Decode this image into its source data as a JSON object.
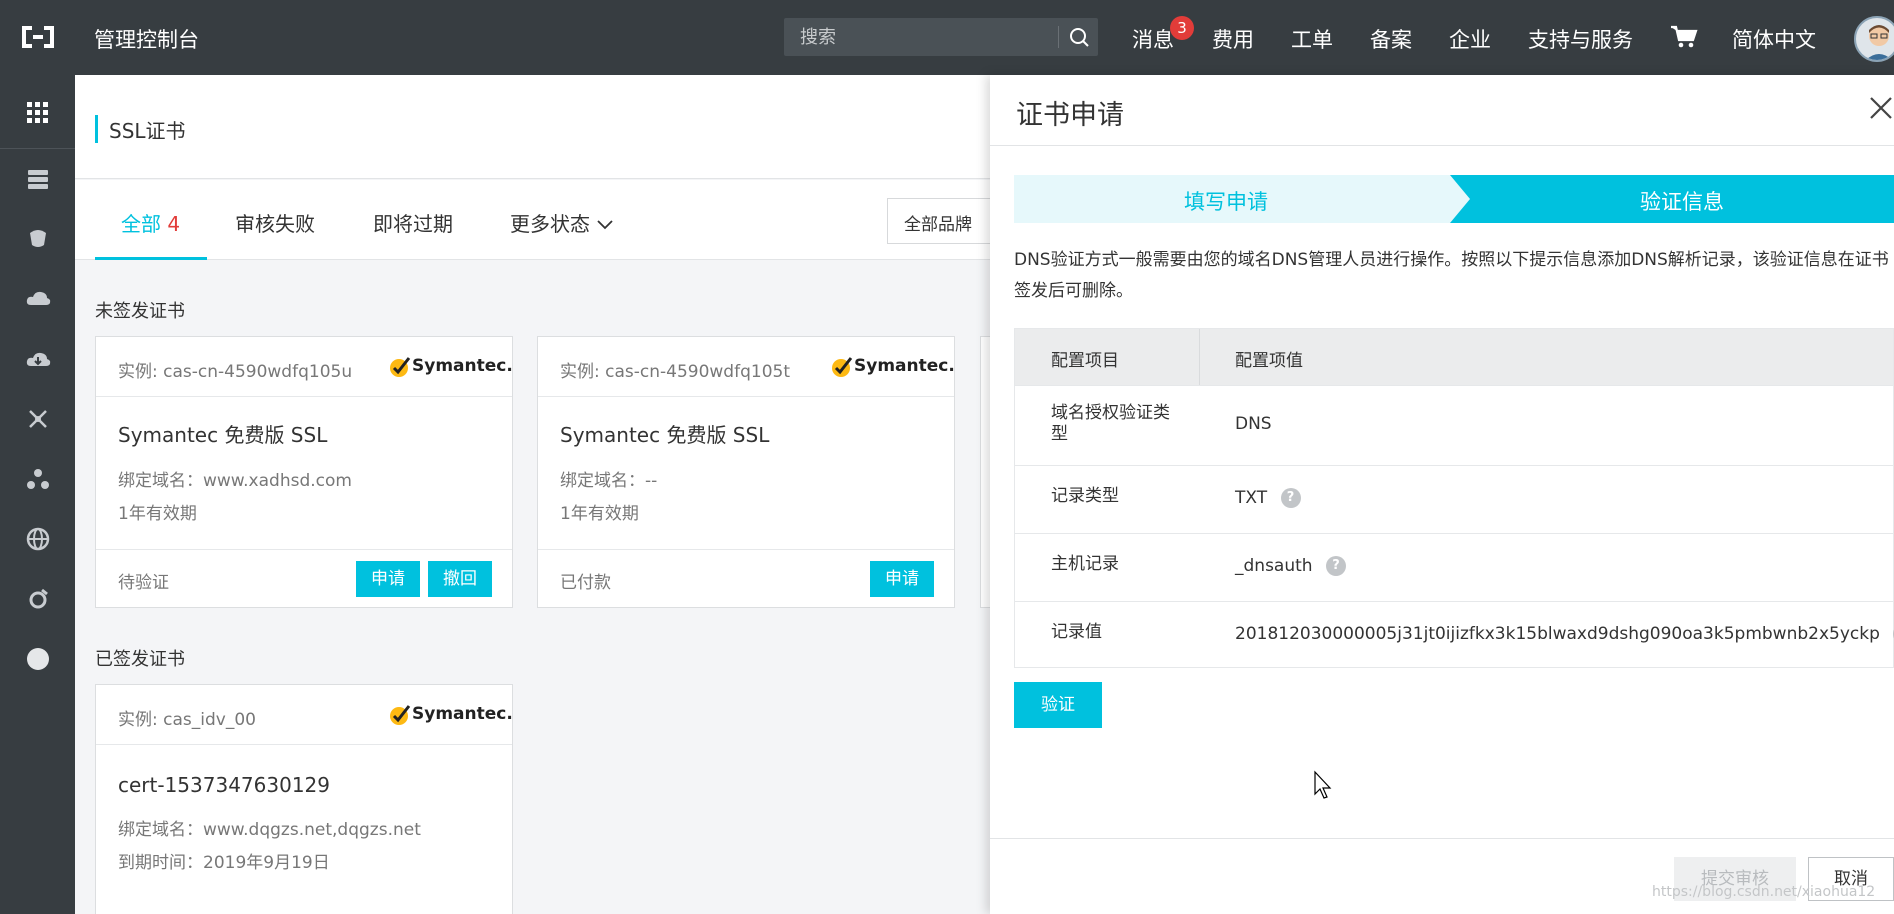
{
  "topbar": {
    "title": "管理控制台",
    "search_placeholder": "搜索",
    "nav": [
      {
        "label": "消息"
      },
      {
        "label": "费用"
      },
      {
        "label": "工单"
      },
      {
        "label": "备案"
      },
      {
        "label": "企业"
      },
      {
        "label": "支持与服务"
      },
      {
        "label": "简体中文"
      }
    ],
    "message_count": "3"
  },
  "header": {
    "title": "SSL证书"
  },
  "tabs": {
    "all_label": "全部",
    "all_count": "4",
    "items": [
      "审核失败",
      "即将过期",
      "更多状态"
    ],
    "brand_filter": "全部品牌"
  },
  "sections": {
    "unissued": "未签发证书",
    "issued": "已签发证书"
  },
  "cards": [
    {
      "instance": "实例: cas-cn-4590wdfq105u",
      "brand": "Symantec.",
      "name": "Symantec 免费版 SSL",
      "domain": "绑定域名：www.xadhsd.com",
      "validity": "1年有效期",
      "status": "待验证",
      "actions": [
        "申请",
        "撤回"
      ]
    },
    {
      "instance": "实例: cas-cn-4590wdfq105t",
      "brand": "Symantec.",
      "name": "Symantec 免费版 SSL",
      "domain": "绑定域名：--",
      "validity": "1年有效期",
      "status": "已付款",
      "actions": [
        "申请"
      ]
    },
    {
      "instance": "实例: cas_idv_00",
      "brand": "Symantec.",
      "name": "cert-1537347630129",
      "domain": "绑定域名：www.dqgzs.net,dqgzs.net",
      "validity": "到期时间：2019年9月19日"
    }
  ],
  "drawer": {
    "title": "证书申请",
    "steps": [
      "填写申请",
      "验证信息"
    ],
    "description": "DNS验证方式一般需要由您的域名DNS管理人员进行操作。按照以下提示信息添加DNS解析记录，该验证信息在证书签发后可删除。",
    "table_headers": [
      "配置项目",
      "配置项值"
    ],
    "rows": [
      {
        "key": "域名授权验证类型",
        "value": "DNS"
      },
      {
        "key": "记录类型",
        "value": "TXT"
      },
      {
        "key": "主机记录",
        "value": "_dnsauth"
      },
      {
        "key": "记录值",
        "value": "201812030000005j31jt0ijizfkx3k15blwaxd9dshg090oa3k5pmbwnb2x5yckp"
      }
    ],
    "help_glyph": "?",
    "verify_label": "验证",
    "submit_label": "提交审核",
    "cancel_label": "取消"
  },
  "watermark": "https://blog.csdn.net/xiaohua12",
  "colors": {
    "accent": "#00c1de",
    "topbar": "#373d41",
    "badge": "#e23c39"
  }
}
